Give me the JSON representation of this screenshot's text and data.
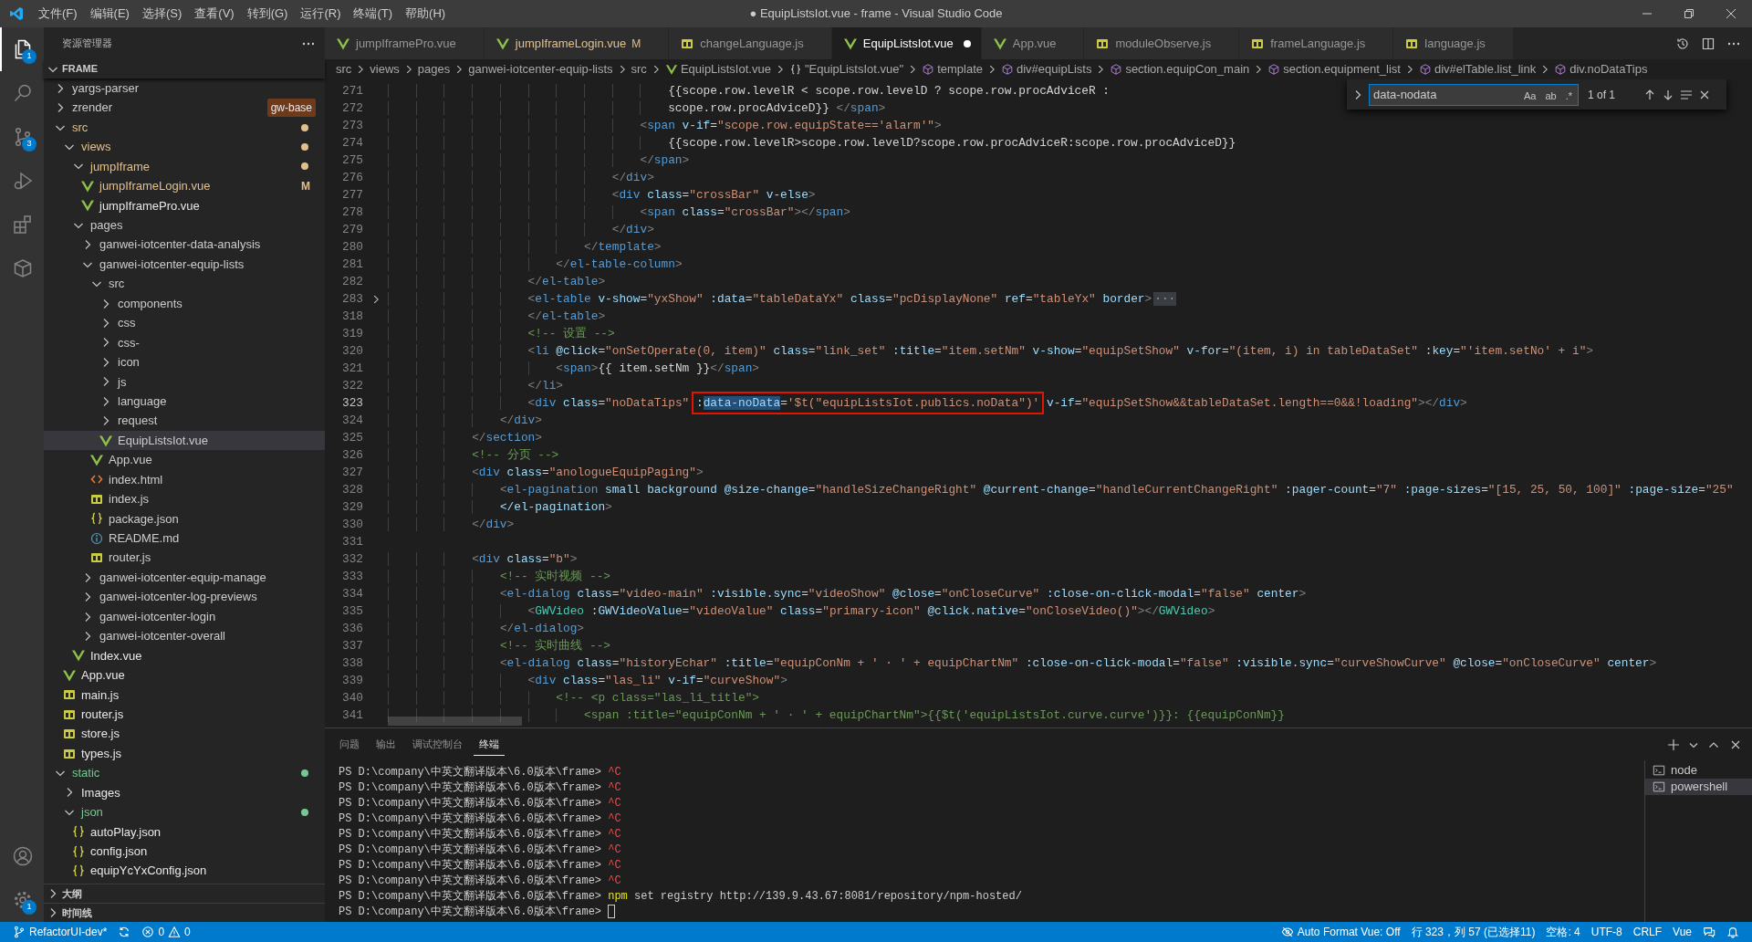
{
  "window": {
    "title": "● EquipListsIot.vue - frame - Visual Studio Code"
  },
  "menu": [
    "文件(F)",
    "编辑(E)",
    "选择(S)",
    "查看(V)",
    "转到(G)",
    "运行(R)",
    "终端(T)",
    "帮助(H)"
  ],
  "activity_bar": {
    "top": [
      {
        "kind": "files",
        "selected": true,
        "badge": "1"
      },
      {
        "kind": "search",
        "selected": false
      },
      {
        "kind": "source-control",
        "selected": false,
        "badge": "3"
      },
      {
        "kind": "run",
        "selected": false
      },
      {
        "kind": "extensions",
        "selected": false
      },
      {
        "kind": "package",
        "selected": false
      }
    ],
    "bottom": [
      {
        "kind": "account",
        "selected": false
      },
      {
        "kind": "settings",
        "selected": false,
        "badge": "1"
      }
    ]
  },
  "explorer": {
    "title": "资源管理器",
    "section": {
      "title": "FRAME",
      "expanded": true
    },
    "tree": [
      {
        "label": "yargs-parser",
        "kind": "folder",
        "expanded": false,
        "selected": false,
        "color": "#cccccc",
        "dot": false
      },
      {
        "label": "zrender",
        "kind": "folder",
        "expanded": false,
        "selected": false,
        "color": "#cccccc",
        "dot": false,
        "tag": "gw-base"
      },
      {
        "label": "src",
        "kind": "folder",
        "expanded": true,
        "selected": false,
        "color": "#e2c08d",
        "dot": true,
        "children": [
          {
            "label": "views",
            "kind": "folder",
            "expanded": true,
            "selected": false,
            "color": "#e2c08d",
            "dot": true,
            "children": [
              {
                "label": "jumpIframe",
                "kind": "folder",
                "expanded": true,
                "selected": false,
                "color": "#e2c08d",
                "dot": true,
                "children": [
                  {
                    "label": "jumpIframeLogin.vue",
                    "kind": "vue",
                    "selected": false,
                    "color": "#e2c08d",
                    "badge": "M"
                  },
                  {
                    "label": "jumpIframePro.vue",
                    "kind": "vue",
                    "selected": false,
                    "color": "#e8e8e8"
                  }
                ]
              },
              {
                "label": "pages",
                "kind": "folder",
                "expanded": true,
                "selected": false,
                "color": "#cccccc",
                "dot": false,
                "children": [
                  {
                    "label": "ganwei-iotcenter-data-analysis",
                    "kind": "folder",
                    "expanded": false,
                    "selected": false,
                    "color": "#cccccc",
                    "dot": false
                  },
                  {
                    "label": "ganwei-iotcenter-equip-lists",
                    "kind": "folder",
                    "expanded": true,
                    "selected": false,
                    "color": "#cccccc",
                    "dot": false,
                    "children": [
                      {
                        "label": "src",
                        "kind": "folder",
                        "expanded": true,
                        "selected": false,
                        "color": "#cccccc",
                        "dot": false,
                        "children": [
                          {
                            "label": "components",
                            "kind": "folder",
                            "expanded": false,
                            "selected": false,
                            "color": "#cccccc",
                            "dot": false
                          },
                          {
                            "label": "css",
                            "kind": "folder",
                            "expanded": false,
                            "selected": false,
                            "color": "#cccccc",
                            "dot": false
                          },
                          {
                            "label": "css-",
                            "kind": "folder",
                            "expanded": false,
                            "selected": false,
                            "color": "#cccccc",
                            "dot": false
                          },
                          {
                            "label": "icon",
                            "kind": "folder",
                            "expanded": false,
                            "selected": false,
                            "color": "#cccccc",
                            "dot": false
                          },
                          {
                            "label": "js",
                            "kind": "folder",
                            "expanded": false,
                            "selected": false,
                            "color": "#cccccc",
                            "dot": false
                          },
                          {
                            "label": "language",
                            "kind": "folder",
                            "expanded": false,
                            "selected": false,
                            "color": "#cccccc",
                            "dot": false
                          },
                          {
                            "label": "request",
                            "kind": "folder",
                            "expanded": false,
                            "selected": false,
                            "color": "#cccccc",
                            "dot": false
                          },
                          {
                            "label": "EquipListsIot.vue",
                            "kind": "vue",
                            "selected": true,
                            "color": "#cccccc"
                          }
                        ]
                      },
                      {
                        "label": "App.vue",
                        "kind": "vue",
                        "selected": false,
                        "color": "#cccccc"
                      },
                      {
                        "label": "index.html",
                        "kind": "html",
                        "selected": false,
                        "color": "#cccccc"
                      },
                      {
                        "label": "index.js",
                        "kind": "js",
                        "selected": false,
                        "color": "#cccccc"
                      },
                      {
                        "label": "package.json",
                        "kind": "json",
                        "selected": false,
                        "color": "#cccccc"
                      },
                      {
                        "label": "README.md",
                        "kind": "md",
                        "selected": false,
                        "color": "#cccccc"
                      },
                      {
                        "label": "router.js",
                        "kind": "js",
                        "selected": false,
                        "color": "#cccccc"
                      }
                    ]
                  },
                  {
                    "label": "ganwei-iotcenter-equip-manage",
                    "kind": "folder",
                    "expanded": false,
                    "selected": false,
                    "color": "#cccccc",
                    "dot": false
                  },
                  {
                    "label": "ganwei-iotcenter-log-previews",
                    "kind": "folder",
                    "expanded": false,
                    "selected": false,
                    "color": "#cccccc",
                    "dot": false
                  },
                  {
                    "label": "ganwei-iotcenter-login",
                    "kind": "folder",
                    "expanded": false,
                    "selected": false,
                    "color": "#cccccc",
                    "dot": false
                  },
                  {
                    "label": "ganwei-iotcenter-overall",
                    "kind": "folder",
                    "expanded": false,
                    "selected": false,
                    "color": "#cccccc",
                    "dot": false
                  }
                ]
              },
              {
                "label": "Index.vue",
                "kind": "vue",
                "selected": false,
                "color": "#e8e8e8"
              }
            ]
          },
          {
            "label": "App.vue",
            "kind": "vue",
            "selected": false,
            "color": "#e8e8e8"
          },
          {
            "label": "main.js",
            "kind": "js",
            "selected": false,
            "color": "#e8e8e8"
          },
          {
            "label": "router.js",
            "kind": "js",
            "selected": false,
            "color": "#e8e8e8"
          },
          {
            "label": "store.js",
            "kind": "js",
            "selected": false,
            "color": "#e8e8e8"
          },
          {
            "label": "types.js",
            "kind": "js",
            "selected": false,
            "color": "#e8e8e8"
          }
        ]
      },
      {
        "label": "static",
        "kind": "folder",
        "expanded": true,
        "selected": false,
        "color": "#73c991",
        "dot": true,
        "children": [
          {
            "label": "Images",
            "kind": "folder",
            "expanded": false,
            "selected": false,
            "color": "#e8e8e8",
            "dot": false
          },
          {
            "label": "json",
            "kind": "folder",
            "expanded": true,
            "selected": false,
            "color": "#73c991",
            "dot": true,
            "children": [
              {
                "label": "autoPlay.json",
                "kind": "json",
                "selected": false,
                "color": "#e8e8e8"
              },
              {
                "label": "config.json",
                "kind": "json",
                "selected": false,
                "color": "#e8e8e8"
              },
              {
                "label": "equipYcYxConfig.json",
                "kind": "json",
                "selected": false,
                "color": "#e8e8e8"
              }
            ]
          }
        ]
      }
    ],
    "bottom_sections": [
      {
        "title": "大纲",
        "expanded": false
      },
      {
        "title": "时间线",
        "expanded": false
      }
    ]
  },
  "editor": {
    "tabs": [
      {
        "label": "jumpIframePro.vue",
        "kind": "vue",
        "selected": false,
        "dirty": false,
        "modified": false
      },
      {
        "label": "jumpIframeLogin.vue",
        "kind": "vue",
        "selected": false,
        "dirty": false,
        "modified": true,
        "badge": "M"
      },
      {
        "label": "changeLanguage.js",
        "kind": "js",
        "selected": false,
        "dirty": false,
        "modified": false
      },
      {
        "label": "EquipListsIot.vue",
        "kind": "vue",
        "selected": true,
        "dirty": true,
        "modified": false
      },
      {
        "label": "App.vue",
        "kind": "vue",
        "selected": false,
        "dirty": false,
        "modified": false
      },
      {
        "label": "moduleObserve.js",
        "kind": "js",
        "selected": false,
        "dirty": false,
        "modified": false
      },
      {
        "label": "frameLanguage.js",
        "kind": "js",
        "selected": false,
        "dirty": false,
        "modified": false
      },
      {
        "label": "language.js",
        "kind": "js",
        "selected": false,
        "dirty": false,
        "modified": false
      }
    ],
    "breadcrumbs": [
      {
        "label": "src",
        "kind": "folder"
      },
      {
        "label": "views",
        "kind": "folder"
      },
      {
        "label": "pages",
        "kind": "folder"
      },
      {
        "label": "ganwei-iotcenter-equip-lists",
        "kind": "folder"
      },
      {
        "label": "src",
        "kind": "folder"
      },
      {
        "label": "EquipListsIot.vue",
        "kind": "vue"
      },
      {
        "label": "\"EquipListsIot.vue\"",
        "kind": "object"
      },
      {
        "label": "template",
        "kind": "element"
      },
      {
        "label": "div#equipLists",
        "kind": "element"
      },
      {
        "label": "section.equipCon_main",
        "kind": "element"
      },
      {
        "label": "section.equipment_list",
        "kind": "element"
      },
      {
        "label": "div#elTable.list_link",
        "kind": "element"
      },
      {
        "label": "div.noDataTips",
        "kind": "element"
      }
    ],
    "find": {
      "value": "data-nodata",
      "options": [
        {
          "label": "Aa",
          "on": false
        },
        {
          "label": "ab",
          "on": false
        },
        {
          "label": ".*",
          "on": false
        }
      ],
      "result": "1 of 1"
    },
    "lines": [
      {
        "number": "271",
        "current": false,
        "folded": false,
        "text": "                                        {{scope.row.levelR < scope.row.levelD ? scope.row.procAdviceR :"
      },
      {
        "number": "272",
        "current": false,
        "folded": false,
        "text": "                                        scope.row.procAdviceD}} </span>"
      },
      {
        "number": "273",
        "current": false,
        "folded": false,
        "text": "                                    <span v-if=\"scope.row.equipState=='alarm'\">"
      },
      {
        "number": "274",
        "current": false,
        "folded": false,
        "text": "                                        {{scope.row.levelR>scope.row.levelD?scope.row.procAdviceR:scope.row.procAdviceD}}"
      },
      {
        "number": "275",
        "current": false,
        "folded": false,
        "text": "                                    </span>"
      },
      {
        "number": "276",
        "current": false,
        "folded": false,
        "text": "                                </div>"
      },
      {
        "number": "277",
        "current": false,
        "folded": false,
        "text": "                                <div class=\"crossBar\" v-else>"
      },
      {
        "number": "278",
        "current": false,
        "folded": false,
        "text": "                                    <span class=\"crossBar\"></span>"
      },
      {
        "number": "279",
        "current": false,
        "folded": false,
        "text": "                                </div>"
      },
      {
        "number": "280",
        "current": false,
        "folded": false,
        "text": "                            </template>"
      },
      {
        "number": "281",
        "current": false,
        "folded": false,
        "text": "                        </el-table-column>"
      },
      {
        "number": "282",
        "current": false,
        "folded": false,
        "text": "                    </el-table>"
      },
      {
        "number": "283",
        "current": false,
        "folded": true,
        "fold_text": "···",
        "text": "                    <el-table v-show=\"yxShow\" :data=\"tableDataYx\" class=\"pcDisplayNone\" ref=\"tableYx\" border>"
      },
      {
        "number": "318",
        "current": false,
        "folded": false,
        "text": "                    </el-table>"
      },
      {
        "number": "319",
        "current": false,
        "folded": false,
        "text": "                    <!-- 设置 -->"
      },
      {
        "number": "320",
        "current": false,
        "folded": false,
        "text": "                    <li @click=\"onSetOperate(0, item)\" class=\"link_set\" :title=\"item.setNm\" v-show=\"equipSetShow\" v-for=\"(item, i) in tableDataSet\" :key=\"'item.setNo' + i\">"
      },
      {
        "number": "321",
        "current": false,
        "folded": false,
        "text": "                        <span>{{ item.setNm }}</span>"
      },
      {
        "number": "322",
        "current": false,
        "folded": false,
        "text": "                    </li>"
      },
      {
        "number": "323",
        "current": true,
        "folded": false,
        "parts": [
          {
            "text": "                    <div class=\"noDataTips\" ",
            "boxed": false,
            "selected": false
          },
          {
            "text": ":",
            "boxed": true,
            "selected": false
          },
          {
            "text": "data-noData",
            "boxed": true,
            "selected": true
          },
          {
            "text": "='$t(\"equipListsIot.publics.noData\")'",
            "boxed": true,
            "selected": false
          },
          {
            "text": " v-if=\"equipSetShow&&tableDataSet.length==0&&!loading\"></div>",
            "boxed": false,
            "selected": false
          }
        ]
      },
      {
        "number": "324",
        "current": false,
        "folded": false,
        "text": "                </div>"
      },
      {
        "number": "325",
        "current": false,
        "folded": false,
        "text": "            </section>"
      },
      {
        "number": "326",
        "current": false,
        "folded": false,
        "text": "            <!-- 分页 -->"
      },
      {
        "number": "327",
        "current": false,
        "folded": false,
        "text": "            <div class=\"anologueEquipPaging\">"
      },
      {
        "number": "328",
        "current": false,
        "folded": false,
        "text": "                <el-pagination small background @size-change=\"handleSizeChangeRight\" @current-change=\"handleCurrentChangeRight\" :pager-count=\"7\" :page-sizes=\"[15, 25, 50, 100]\" :page-size=\"25\""
      },
      {
        "number": "329",
        "current": false,
        "folded": false,
        "text": "                </el-pagination>"
      },
      {
        "number": "330",
        "current": false,
        "folded": false,
        "text": "            </div>"
      },
      {
        "number": "331",
        "current": false,
        "folded": false
      },
      {
        "number": "332",
        "current": false,
        "folded": false,
        "text": "            <div class=\"b\">"
      },
      {
        "number": "333",
        "current": false,
        "folded": false,
        "text": "                <!-- 实时视频 -->"
      },
      {
        "number": "334",
        "current": false,
        "folded": false,
        "text": "                <el-dialog class=\"video-main\" :visible.sync=\"videoShow\" @close=\"onCloseCurve\" :close-on-click-modal=\"false\" center>"
      },
      {
        "number": "335",
        "current": false,
        "folded": false,
        "text": "                    <GWVideo :GWVideoValue=\"videoValue\" class=\"primary-icon\" @click.native=\"onCloseVideo()\"></GWVideo>"
      },
      {
        "number": "336",
        "current": false,
        "folded": false,
        "text": "                </el-dialog>"
      },
      {
        "number": "337",
        "current": false,
        "folded": false,
        "text": "                <!-- 实时曲线 -->"
      },
      {
        "number": "338",
        "current": false,
        "folded": false,
        "text": "                <el-dialog class=\"historyEchar\" :title=\"equipConNm + ' · ' + equipChartNm\" :close-on-click-modal=\"false\" :visible.sync=\"curveShowCurve\" @close=\"onCloseCurve\" center>"
      },
      {
        "number": "339",
        "current": false,
        "folded": false,
        "text": "                    <div class=\"las_li\" v-if=\"curveShow\">"
      },
      {
        "number": "340",
        "current": false,
        "folded": false,
        "text": "                        <!-- <p class=\"las_li_title\">"
      },
      {
        "number": "341",
        "current": false,
        "folded": false,
        "text": "                            <span :title=\"equipConNm + ' · ' + equipChartNm\">{{$t('equipListsIot.curve.curve')}}: {{equipConNm}}"
      }
    ]
  },
  "panel": {
    "tabs": [
      {
        "label": "问题",
        "selected": false
      },
      {
        "label": "输出",
        "selected": false
      },
      {
        "label": "调试控制台",
        "selected": false
      },
      {
        "label": "终端",
        "selected": true
      }
    ],
    "terminal": [
      {
        "kind": "interrupt",
        "prompt": "PS D:\\company\\中英文翻译版本\\6.0版本\\frame>",
        "text": "^C"
      },
      {
        "kind": "interrupt",
        "prompt": "PS D:\\company\\中英文翻译版本\\6.0版本\\frame>",
        "text": "^C"
      },
      {
        "kind": "interrupt",
        "prompt": "PS D:\\company\\中英文翻译版本\\6.0版本\\frame>",
        "text": "^C"
      },
      {
        "kind": "interrupt",
        "prompt": "PS D:\\company\\中英文翻译版本\\6.0版本\\frame>",
        "text": "^C"
      },
      {
        "kind": "interrupt",
        "prompt": "PS D:\\company\\中英文翻译版本\\6.0版本\\frame>",
        "text": "^C"
      },
      {
        "kind": "interrupt",
        "prompt": "PS D:\\company\\中英文翻译版本\\6.0版本\\frame>",
        "text": "^C"
      },
      {
        "kind": "interrupt",
        "prompt": "PS D:\\company\\中英文翻译版本\\6.0版本\\frame>",
        "text": "^C"
      },
      {
        "kind": "interrupt",
        "prompt": "PS D:\\company\\中英文翻译版本\\6.0版本\\frame>",
        "text": "^C"
      },
      {
        "kind": "command",
        "prompt": "PS D:\\company\\中英文翻译版本\\6.0版本\\frame>",
        "program": "npm",
        "text": "set registry http://139.9.43.67:8081/repository/npm-hosted/"
      },
      {
        "kind": "cursor",
        "prompt": "PS D:\\company\\中英文翻译版本\\6.0版本\\frame>"
      }
    ],
    "terminals": [
      {
        "label": "node",
        "selected": false
      },
      {
        "label": "powershell",
        "selected": true
      }
    ]
  },
  "status_bar": {
    "left": [
      {
        "kind": "branch",
        "label": "RefactorUI-dev*"
      },
      {
        "kind": "sync"
      },
      {
        "kind": "problems",
        "errors": "0",
        "warnings": "0"
      }
    ],
    "right": [
      {
        "kind": "eye-off",
        "label": "Auto Format Vue: Off"
      },
      {
        "kind": "text",
        "label": "行 323，列 57 (已选择11)"
      },
      {
        "kind": "text",
        "label": "空格: 4"
      },
      {
        "kind": "text",
        "label": "UTF-8"
      },
      {
        "kind": "text",
        "label": "CRLF"
      },
      {
        "kind": "text",
        "label": "Vue"
      },
      {
        "kind": "feedback"
      },
      {
        "kind": "bell"
      }
    ]
  }
}
